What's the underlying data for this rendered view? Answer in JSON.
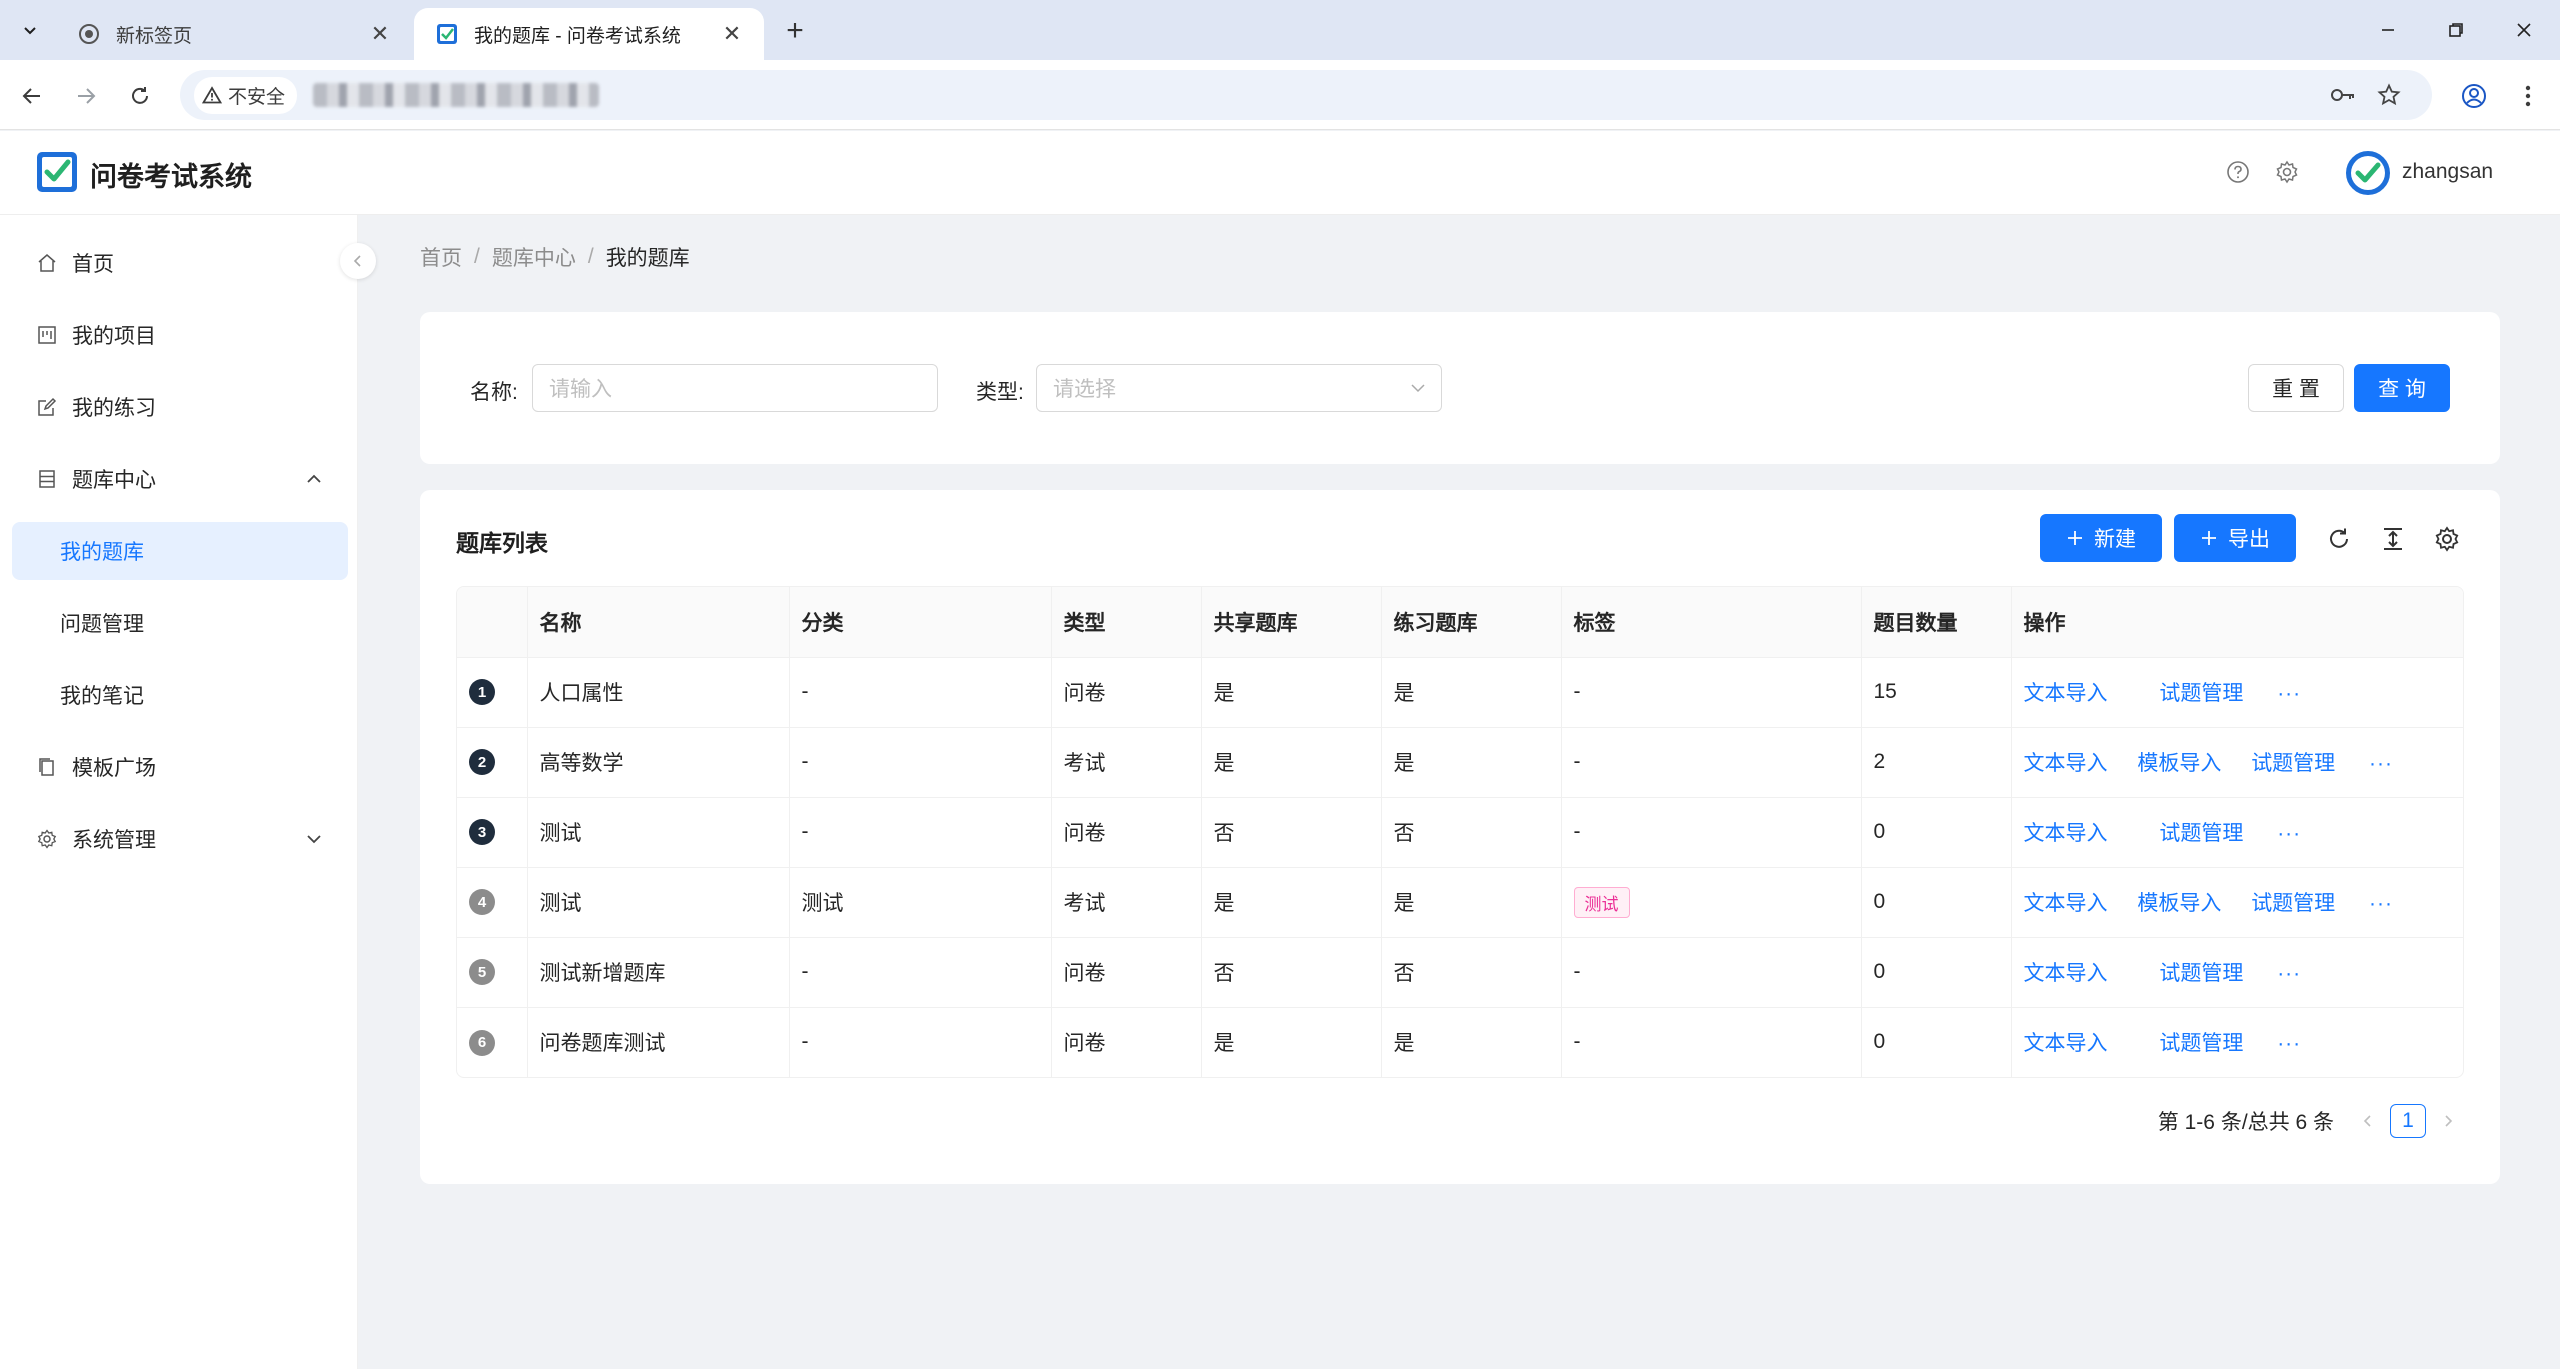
{
  "browser": {
    "tabs": [
      {
        "title": "新标签页"
      },
      {
        "title": "我的题库 - 问卷考试系统"
      }
    ],
    "security_label": "不安全"
  },
  "header": {
    "app_title": "问卷考试系统",
    "username": "zhangsan"
  },
  "sidebar": {
    "items": [
      {
        "label": "首页",
        "icon": "home-icon"
      },
      {
        "label": "我的项目",
        "icon": "project-icon"
      },
      {
        "label": "我的练习",
        "icon": "edit-icon"
      },
      {
        "label": "题库中心",
        "icon": "database-icon"
      },
      {
        "label": "我的题库"
      },
      {
        "label": "问题管理"
      },
      {
        "label": "我的笔记"
      },
      {
        "label": "模板广场",
        "icon": "copy-icon"
      },
      {
        "label": "系统管理",
        "icon": "gear-icon"
      }
    ]
  },
  "breadcrumb": [
    "首页",
    "题库中心",
    "我的题库"
  ],
  "search": {
    "name_label": "名称:",
    "name_placeholder": "请输入",
    "type_label": "类型:",
    "type_placeholder": "请选择",
    "reset_label": "重 置",
    "query_label": "查 询"
  },
  "table": {
    "title": "题库列表",
    "new_label": "新建",
    "export_label": "导出",
    "columns": [
      "名称",
      "分类",
      "类型",
      "共享题库",
      "练习题库",
      "标签",
      "题目数量",
      "操作"
    ],
    "rows": [
      {
        "index": "1",
        "name": "人口属性",
        "category": "-",
        "type": "问卷",
        "shared": "是",
        "practice": "是",
        "tag": "-",
        "count": "15",
        "actions": [
          "文本导入",
          "试题管理"
        ]
      },
      {
        "index": "2",
        "name": "高等数学",
        "category": "-",
        "type": "考试",
        "shared": "是",
        "practice": "是",
        "tag": "-",
        "count": "2",
        "actions": [
          "文本导入",
          "模板导入",
          "试题管理"
        ]
      },
      {
        "index": "3",
        "name": "测试",
        "category": "-",
        "type": "问卷",
        "shared": "否",
        "practice": "否",
        "tag": "-",
        "count": "0",
        "actions": [
          "文本导入",
          "试题管理"
        ]
      },
      {
        "index": "4",
        "name": "测试",
        "category": "测试",
        "type": "考试",
        "shared": "是",
        "practice": "是",
        "tag": "测试",
        "count": "0",
        "actions": [
          "文本导入",
          "模板导入",
          "试题管理"
        ]
      },
      {
        "index": "5",
        "name": "测试新增题库",
        "category": "-",
        "type": "问卷",
        "shared": "否",
        "practice": "否",
        "tag": "-",
        "count": "0",
        "actions": [
          "文本导入",
          "试题管理"
        ]
      },
      {
        "index": "6",
        "name": "问卷题库测试",
        "category": "-",
        "type": "问卷",
        "shared": "是",
        "practice": "是",
        "tag": "-",
        "count": "0",
        "actions": [
          "文本导入",
          "试题管理"
        ]
      }
    ],
    "more_label": "···"
  },
  "pagination": {
    "summary": "第 1-6 条/总共 6 条",
    "current_page": "1"
  },
  "colors": {
    "primary": "#1677ff",
    "tag_text": "#eb2f96",
    "tag_bg": "#fff0f6"
  }
}
